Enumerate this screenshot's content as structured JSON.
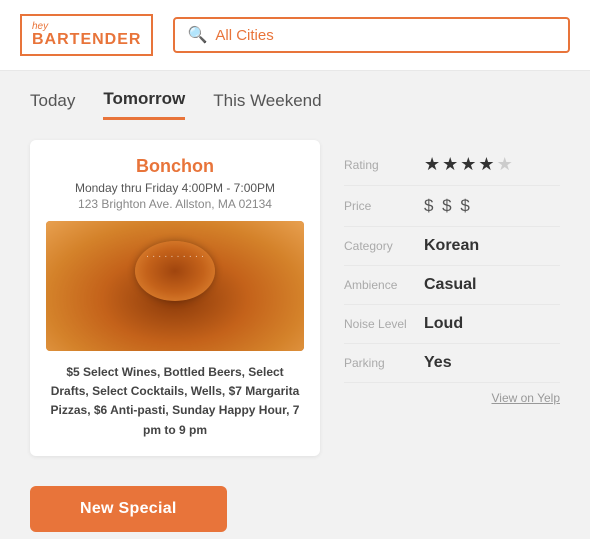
{
  "header": {
    "logo_hey": "hey",
    "logo_bartender": "BARTENDER",
    "search_placeholder": "All Cities",
    "search_text": "All Cities"
  },
  "tabs": [
    {
      "id": "today",
      "label": "Today",
      "active": false
    },
    {
      "id": "tomorrow",
      "label": "Tomorrow",
      "active": true
    },
    {
      "id": "weekend",
      "label": "This Weekend",
      "active": false
    }
  ],
  "card": {
    "name": "Bonchon",
    "hours": "Monday thru Friday 4:00PM - 7:00PM",
    "address": "123 Brighton Ave. Allston, MA 02134",
    "description": "$5 Select Wines, Bottled Beers, Select Drafts, Select Cocktails, Wells, $7 Margarita Pizzas, $6 Anti-pasti, Sunday Happy Hour, 7 pm to 9 pm"
  },
  "details": {
    "rating_label": "Rating",
    "rating_stars": 4,
    "rating_max": 5,
    "price_label": "Price",
    "price_value": "$ $ $",
    "category_label": "Category",
    "category_value": "Korean",
    "ambience_label": "Ambience",
    "ambience_value": "Casual",
    "noise_label": "Noise Level",
    "noise_value": "Loud",
    "parking_label": "Parking",
    "parking_value": "Yes",
    "yelp_link": "View on Yelp"
  },
  "new_special_button": "New Special",
  "colors": {
    "accent": "#e8743a"
  }
}
